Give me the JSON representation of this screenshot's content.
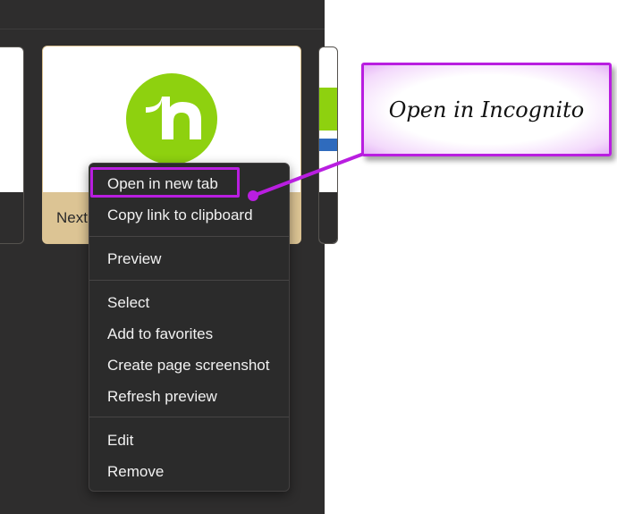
{
  "tiles": {
    "main": {
      "caption": "Next"
    }
  },
  "context_menu": {
    "groups": [
      [
        "Open in new tab",
        "Copy link to clipboard"
      ],
      [
        "Preview"
      ],
      [
        "Select",
        "Add to favorites",
        "Create page screenshot",
        "Refresh preview"
      ],
      [
        "Edit",
        "Remove"
      ]
    ]
  },
  "annotation": {
    "callout_text": "Open in Incognito",
    "highlighted_item": "Open in new tab",
    "color": "#b91ee0"
  },
  "colors": {
    "panel_bg": "#2e2d2d",
    "menu_bg": "#2b2b2b",
    "logo_green": "#8ed10f",
    "caption_bg": "#dcc494"
  },
  "icons": {
    "tile_logo": "nextdoor-logo"
  }
}
